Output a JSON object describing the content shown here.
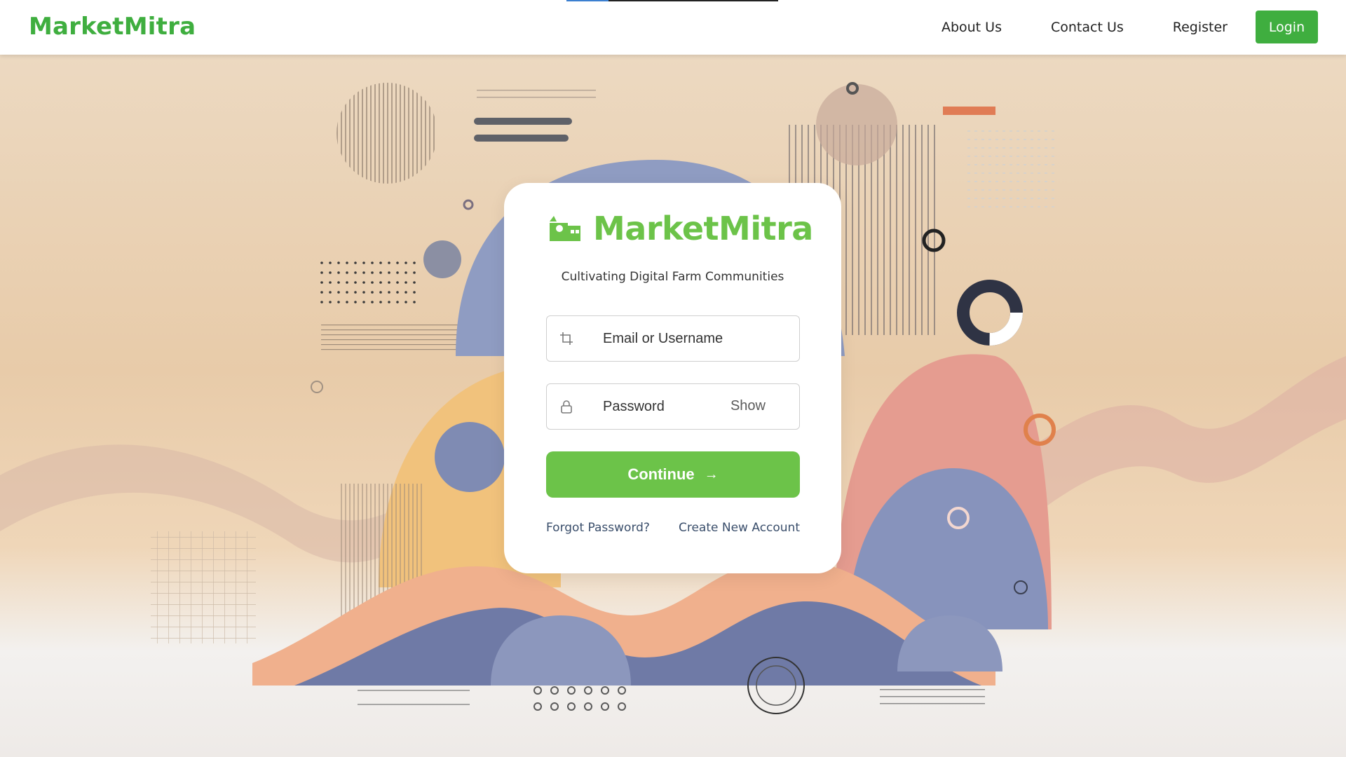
{
  "header": {
    "brand": "MarketMitra",
    "nav": [
      "About Us",
      "Contact Us",
      "Register"
    ],
    "login_label": "Login"
  },
  "card": {
    "title": "MarketMitra",
    "tagline": "Cultivating Digital Farm Communities",
    "email_placeholder": "Email or Username",
    "password_placeholder": "Password",
    "show_label": "Show",
    "continue_label": "Continue",
    "forgot_label": "Forgot Password?",
    "create_label": "Create New Account"
  },
  "icons": {
    "logo": "farm-logo-icon",
    "email": "crop-icon",
    "password": "lock-icon",
    "continue": "arrow-right-icon"
  },
  "colors": {
    "brand_green": "#3fae3f",
    "button_green": "#6cc349"
  }
}
